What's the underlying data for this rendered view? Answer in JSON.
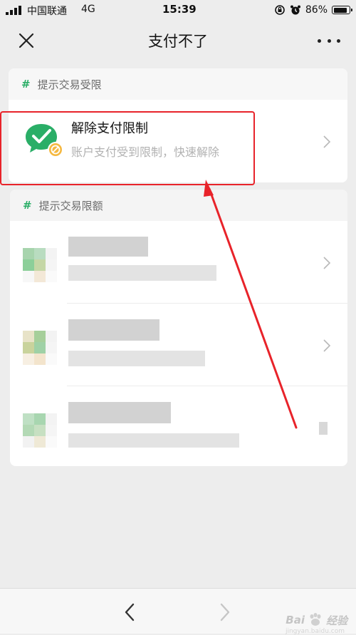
{
  "status_bar": {
    "carrier": "中国联通",
    "network": "4G",
    "time": "15:39",
    "battery": "86%"
  },
  "nav": {
    "title": "支付不了"
  },
  "restriction_section": {
    "header_hash": "#",
    "header": "提示交易受限",
    "item": {
      "title": "解除支付限制",
      "subtitle": "账户支付受到限制，快速解除",
      "icon": "wechat-pay-restriction-icon"
    }
  },
  "limit_section": {
    "header_hash": "#",
    "header": "提示交易限额"
  },
  "watermark": {
    "text": "Bai",
    "text2": "经验",
    "domain": "jingyan.baidu.com"
  },
  "colors": {
    "accent_green": "#2aae67",
    "highlight_red": "#e8232a",
    "background": "#ededed"
  }
}
